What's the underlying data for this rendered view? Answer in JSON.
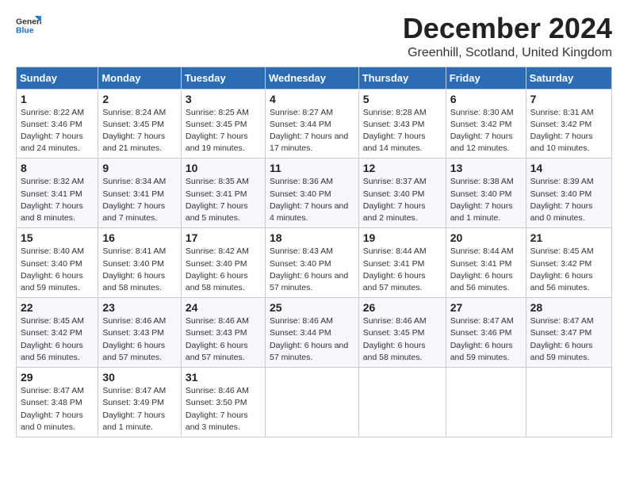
{
  "logo": {
    "general": "General",
    "blue": "Blue"
  },
  "title": "December 2024",
  "location": "Greenhill, Scotland, United Kingdom",
  "days_of_week": [
    "Sunday",
    "Monday",
    "Tuesday",
    "Wednesday",
    "Thursday",
    "Friday",
    "Saturday"
  ],
  "weeks": [
    [
      {
        "day": "1",
        "sunrise": "Sunrise: 8:22 AM",
        "sunset": "Sunset: 3:46 PM",
        "daylight": "Daylight: 7 hours and 24 minutes."
      },
      {
        "day": "2",
        "sunrise": "Sunrise: 8:24 AM",
        "sunset": "Sunset: 3:45 PM",
        "daylight": "Daylight: 7 hours and 21 minutes."
      },
      {
        "day": "3",
        "sunrise": "Sunrise: 8:25 AM",
        "sunset": "Sunset: 3:45 PM",
        "daylight": "Daylight: 7 hours and 19 minutes."
      },
      {
        "day": "4",
        "sunrise": "Sunrise: 8:27 AM",
        "sunset": "Sunset: 3:44 PM",
        "daylight": "Daylight: 7 hours and 17 minutes."
      },
      {
        "day": "5",
        "sunrise": "Sunrise: 8:28 AM",
        "sunset": "Sunset: 3:43 PM",
        "daylight": "Daylight: 7 hours and 14 minutes."
      },
      {
        "day": "6",
        "sunrise": "Sunrise: 8:30 AM",
        "sunset": "Sunset: 3:42 PM",
        "daylight": "Daylight: 7 hours and 12 minutes."
      },
      {
        "day": "7",
        "sunrise": "Sunrise: 8:31 AM",
        "sunset": "Sunset: 3:42 PM",
        "daylight": "Daylight: 7 hours and 10 minutes."
      }
    ],
    [
      {
        "day": "8",
        "sunrise": "Sunrise: 8:32 AM",
        "sunset": "Sunset: 3:41 PM",
        "daylight": "Daylight: 7 hours and 8 minutes."
      },
      {
        "day": "9",
        "sunrise": "Sunrise: 8:34 AM",
        "sunset": "Sunset: 3:41 PM",
        "daylight": "Daylight: 7 hours and 7 minutes."
      },
      {
        "day": "10",
        "sunrise": "Sunrise: 8:35 AM",
        "sunset": "Sunset: 3:41 PM",
        "daylight": "Daylight: 7 hours and 5 minutes."
      },
      {
        "day": "11",
        "sunrise": "Sunrise: 8:36 AM",
        "sunset": "Sunset: 3:40 PM",
        "daylight": "Daylight: 7 hours and 4 minutes."
      },
      {
        "day": "12",
        "sunrise": "Sunrise: 8:37 AM",
        "sunset": "Sunset: 3:40 PM",
        "daylight": "Daylight: 7 hours and 2 minutes."
      },
      {
        "day": "13",
        "sunrise": "Sunrise: 8:38 AM",
        "sunset": "Sunset: 3:40 PM",
        "daylight": "Daylight: 7 hours and 1 minute."
      },
      {
        "day": "14",
        "sunrise": "Sunrise: 8:39 AM",
        "sunset": "Sunset: 3:40 PM",
        "daylight": "Daylight: 7 hours and 0 minutes."
      }
    ],
    [
      {
        "day": "15",
        "sunrise": "Sunrise: 8:40 AM",
        "sunset": "Sunset: 3:40 PM",
        "daylight": "Daylight: 6 hours and 59 minutes."
      },
      {
        "day": "16",
        "sunrise": "Sunrise: 8:41 AM",
        "sunset": "Sunset: 3:40 PM",
        "daylight": "Daylight: 6 hours and 58 minutes."
      },
      {
        "day": "17",
        "sunrise": "Sunrise: 8:42 AM",
        "sunset": "Sunset: 3:40 PM",
        "daylight": "Daylight: 6 hours and 58 minutes."
      },
      {
        "day": "18",
        "sunrise": "Sunrise: 8:43 AM",
        "sunset": "Sunset: 3:40 PM",
        "daylight": "Daylight: 6 hours and 57 minutes."
      },
      {
        "day": "19",
        "sunrise": "Sunrise: 8:44 AM",
        "sunset": "Sunset: 3:41 PM",
        "daylight": "Daylight: 6 hours and 57 minutes."
      },
      {
        "day": "20",
        "sunrise": "Sunrise: 8:44 AM",
        "sunset": "Sunset: 3:41 PM",
        "daylight": "Daylight: 6 hours and 56 minutes."
      },
      {
        "day": "21",
        "sunrise": "Sunrise: 8:45 AM",
        "sunset": "Sunset: 3:42 PM",
        "daylight": "Daylight: 6 hours and 56 minutes."
      }
    ],
    [
      {
        "day": "22",
        "sunrise": "Sunrise: 8:45 AM",
        "sunset": "Sunset: 3:42 PM",
        "daylight": "Daylight: 6 hours and 56 minutes."
      },
      {
        "day": "23",
        "sunrise": "Sunrise: 8:46 AM",
        "sunset": "Sunset: 3:43 PM",
        "daylight": "Daylight: 6 hours and 57 minutes."
      },
      {
        "day": "24",
        "sunrise": "Sunrise: 8:46 AM",
        "sunset": "Sunset: 3:43 PM",
        "daylight": "Daylight: 6 hours and 57 minutes."
      },
      {
        "day": "25",
        "sunrise": "Sunrise: 8:46 AM",
        "sunset": "Sunset: 3:44 PM",
        "daylight": "Daylight: 6 hours and 57 minutes."
      },
      {
        "day": "26",
        "sunrise": "Sunrise: 8:46 AM",
        "sunset": "Sunset: 3:45 PM",
        "daylight": "Daylight: 6 hours and 58 minutes."
      },
      {
        "day": "27",
        "sunrise": "Sunrise: 8:47 AM",
        "sunset": "Sunset: 3:46 PM",
        "daylight": "Daylight: 6 hours and 59 minutes."
      },
      {
        "day": "28",
        "sunrise": "Sunrise: 8:47 AM",
        "sunset": "Sunset: 3:47 PM",
        "daylight": "Daylight: 6 hours and 59 minutes."
      }
    ],
    [
      {
        "day": "29",
        "sunrise": "Sunrise: 8:47 AM",
        "sunset": "Sunset: 3:48 PM",
        "daylight": "Daylight: 7 hours and 0 minutes."
      },
      {
        "day": "30",
        "sunrise": "Sunrise: 8:47 AM",
        "sunset": "Sunset: 3:49 PM",
        "daylight": "Daylight: 7 hours and 1 minute."
      },
      {
        "day": "31",
        "sunrise": "Sunrise: 8:46 AM",
        "sunset": "Sunset: 3:50 PM",
        "daylight": "Daylight: 7 hours and 3 minutes."
      },
      null,
      null,
      null,
      null
    ]
  ]
}
